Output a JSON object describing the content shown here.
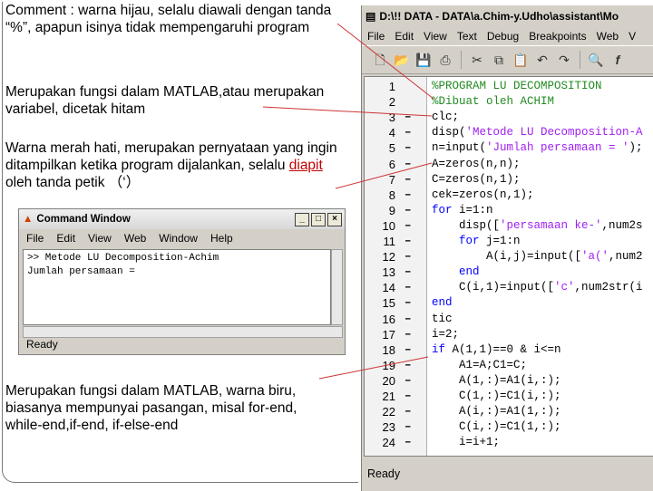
{
  "notes": {
    "comment": "Comment : warna hijau, selalu diawali dengan tanda “%”, apapun isinya tidak mempengaruhi program",
    "function_var": "Merupakan fungsi dalam MATLAB,atau merupakan variabel, dicetak hitam",
    "string_pre": "Warna merah hati, merupakan pernyataan yang ingin ditampilkan ketika program dijalankan, selalu ",
    "string_red": "diapit",
    "string_post": " oleh tanda petik （‘）",
    "keyword": "Merupakan fungsi dalam MATLAB, warna biru, biasanya mempunyai pasangan, misal for-end, while-end,if-end, if-else-end"
  },
  "command_window": {
    "title": "Command Window",
    "menu": [
      "File",
      "Edit",
      "View",
      "Web",
      "Window",
      "Help"
    ],
    "lines": [
      ">> Metode LU Decomposition-Achim",
      "Jumlah persamaan ="
    ],
    "status": "Ready"
  },
  "editor": {
    "title": "D:\\!! DATA - DATA\\a.Chim-y.Udho\\assistant\\Mo",
    "menu": [
      "File",
      "Edit",
      "View",
      "Text",
      "Debug",
      "Breakpoints",
      "Web",
      "V"
    ],
    "toolbar_icons": [
      "new-file-icon",
      "open-folder-icon",
      "save-icon",
      "print-icon",
      "cut-icon",
      "copy-icon",
      "paste-icon",
      "undo-icon",
      "redo-icon",
      "find-icon",
      "function-icon"
    ],
    "status": "Ready",
    "lines": [
      {
        "n": "1",
        "m": "",
        "parts": [
          {
            "c": "cmt",
            "t": "%PROGRAM LU DECOMPOSITION"
          }
        ]
      },
      {
        "n": "2",
        "m": "",
        "parts": [
          {
            "c": "cmt",
            "t": "%Dibuat oleh ACHIM"
          }
        ]
      },
      {
        "n": "3",
        "m": "–",
        "parts": [
          {
            "c": "blk",
            "t": "clc;"
          }
        ]
      },
      {
        "n": "4",
        "m": "–",
        "parts": [
          {
            "c": "blk",
            "t": "disp("
          },
          {
            "c": "str",
            "t": "'Metode LU Decomposition-A"
          }
        ]
      },
      {
        "n": "5",
        "m": "–",
        "parts": [
          {
            "c": "blk",
            "t": "n=input("
          },
          {
            "c": "str",
            "t": "'Jumlah persamaan = '"
          },
          {
            "c": "blk",
            "t": ");"
          }
        ]
      },
      {
        "n": "6",
        "m": "–",
        "parts": [
          {
            "c": "blk",
            "t": "A=zeros(n,n);"
          }
        ]
      },
      {
        "n": "7",
        "m": "–",
        "parts": [
          {
            "c": "blk",
            "t": "C=zeros(n,1);"
          }
        ]
      },
      {
        "n": "8",
        "m": "–",
        "parts": [
          {
            "c": "blk",
            "t": "cek=zeros(n,1);"
          }
        ]
      },
      {
        "n": "9",
        "m": "–",
        "parts": [
          {
            "c": "hl",
            "t": "for"
          },
          {
            "c": "blk",
            "t": " i=1:n"
          }
        ]
      },
      {
        "n": "10",
        "m": "–",
        "parts": [
          {
            "c": "blk",
            "t": "    disp(["
          },
          {
            "c": "str",
            "t": "'persamaan ke-'"
          },
          {
            "c": "blk",
            "t": ",num2s"
          }
        ]
      },
      {
        "n": "11",
        "m": "–",
        "parts": [
          {
            "c": "hl",
            "t": "    for"
          },
          {
            "c": "blk",
            "t": " j=1:n"
          }
        ]
      },
      {
        "n": "12",
        "m": "–",
        "parts": [
          {
            "c": "blk",
            "t": "        A(i,j)=input(["
          },
          {
            "c": "str",
            "t": "'a('"
          },
          {
            "c": "blk",
            "t": ",num2"
          }
        ]
      },
      {
        "n": "13",
        "m": "–",
        "parts": [
          {
            "c": "hl",
            "t": "    end"
          }
        ]
      },
      {
        "n": "14",
        "m": "–",
        "parts": [
          {
            "c": "blk",
            "t": "    C(i,1)=input(["
          },
          {
            "c": "str",
            "t": "'c'"
          },
          {
            "c": "blk",
            "t": ",num2str(i"
          }
        ]
      },
      {
        "n": "15",
        "m": "–",
        "parts": [
          {
            "c": "hl",
            "t": "end"
          }
        ]
      },
      {
        "n": "16",
        "m": "–",
        "parts": [
          {
            "c": "blk",
            "t": "tic"
          }
        ]
      },
      {
        "n": "17",
        "m": "–",
        "parts": [
          {
            "c": "blk",
            "t": "i=2;"
          }
        ]
      },
      {
        "n": "18",
        "m": "–",
        "parts": [
          {
            "c": "hl",
            "t": "if"
          },
          {
            "c": "blk",
            "t": " A(1,1)==0 & i<=n"
          }
        ]
      },
      {
        "n": "19",
        "m": "–",
        "parts": [
          {
            "c": "blk",
            "t": "    A1=A;C1=C;"
          }
        ]
      },
      {
        "n": "20",
        "m": "–",
        "parts": [
          {
            "c": "blk",
            "t": "    A(1,:)=A1(i,:);"
          }
        ]
      },
      {
        "n": "21",
        "m": "–",
        "parts": [
          {
            "c": "blk",
            "t": "    C(1,:)=C1(i,:);"
          }
        ]
      },
      {
        "n": "22",
        "m": "–",
        "parts": [
          {
            "c": "blk",
            "t": "    A(i,:)=A1(1,:);"
          }
        ]
      },
      {
        "n": "23",
        "m": "–",
        "parts": [
          {
            "c": "blk",
            "t": "    C(i,:)=C1(1,:);"
          }
        ]
      },
      {
        "n": "24",
        "m": "–",
        "parts": [
          {
            "c": "blk",
            "t": "    i=i+1;"
          }
        ]
      }
    ]
  },
  "colors": {
    "keyword": "#0000ff",
    "string": "#a020f0",
    "comment": "#228b22",
    "callout_line": "#cc3333"
  }
}
